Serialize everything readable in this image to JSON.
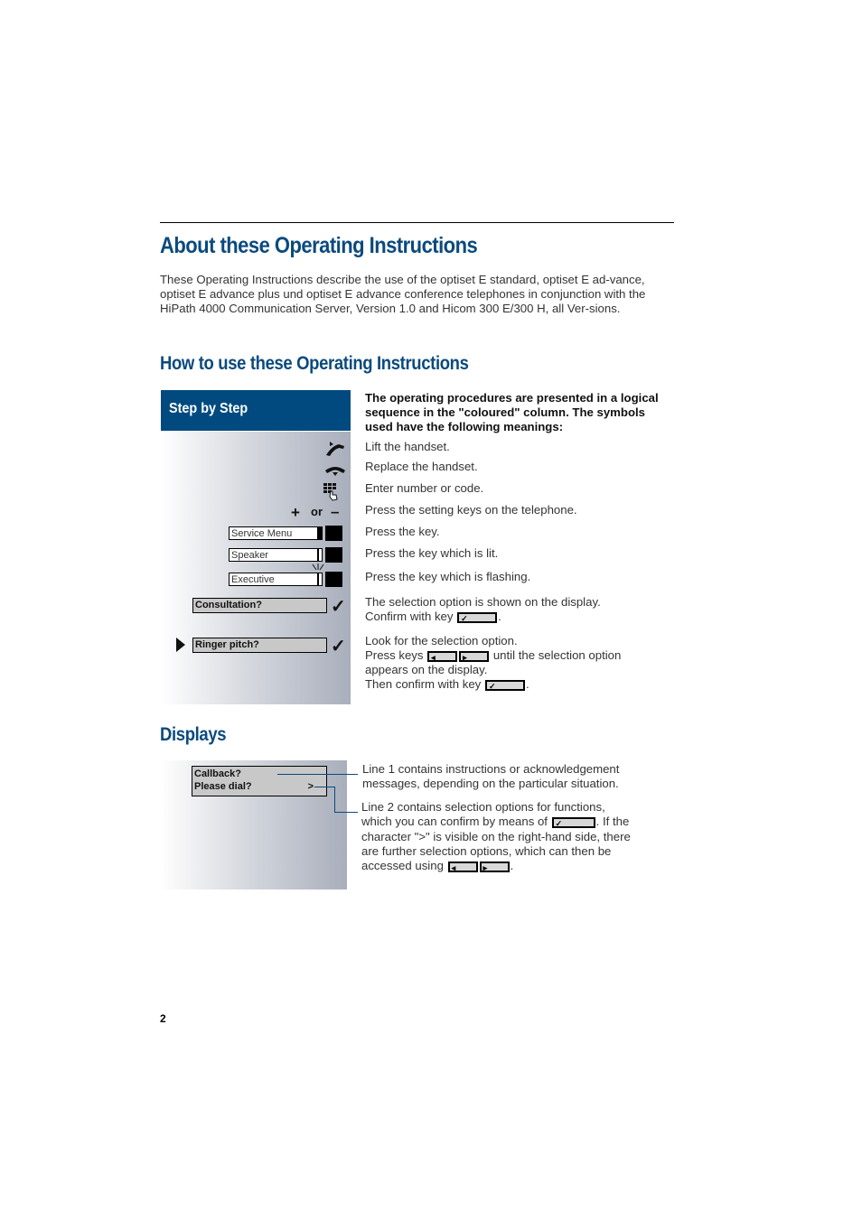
{
  "page": {
    "title": "About these Operating Instructions",
    "intro": "These Operating Instructions describe the use of the optiset E standard, optiset E ad-vance, optiset E advance plus und optiset E advance conference telephones in conjunction with the HiPath 4000 Communication Server, Version 1.0 and Hicom 300 E/300 H, all Ver-sions.",
    "page_number": "2"
  },
  "howto": {
    "heading": "How to use these Operating Instructions",
    "column_header": "Step by Step",
    "lead": "The operating procedures are presented in a logical sequence in the \"coloured\" column. The symbols used have the following meanings:",
    "rows": [
      {
        "icon": "lift-handset-icon",
        "text": "Lift the handset."
      },
      {
        "icon": "replace-handset-icon",
        "text": "Replace the handset."
      },
      {
        "icon": "keypad-icon",
        "text": "Enter number or code."
      },
      {
        "icon": "plus-minus-keys",
        "plus": "+",
        "or": "or",
        "minus": "–",
        "text": "Press the setting keys on the telephone."
      },
      {
        "key_label": "Service Menu",
        "text": "Press the key."
      },
      {
        "key_label": "Speaker",
        "text": "Press the key which is lit."
      },
      {
        "key_label": "Executive",
        "text": "Press the key which is flashing."
      },
      {
        "display": "Consultation?",
        "check": "✓",
        "text1": "The selection option is shown on the display.",
        "text2": "Confirm with key",
        "text2_end": "."
      },
      {
        "display": "Ringer pitch?",
        "check": "✓",
        "text1": "Look for the selection option.",
        "text2": "Press keys",
        "text2_after": "until the selection option",
        "text3": "appears on the display.",
        "text4": "Then confirm with key",
        "text4_end": "."
      }
    ]
  },
  "displays": {
    "heading": "Displays",
    "line1": "Callback?",
    "line2": "Please dial?",
    "more": ">",
    "desc1": "Line 1 contains instructions or acknowledgement messages, depending on the particular situation.",
    "desc2_a": "Line 2 contains selection options for functions,",
    "desc2_b": "which you can confirm by means of",
    "desc2_c": ". If the",
    "desc2_d": "character \">\" is visible on the right-hand side, there",
    "desc2_e": "are further selection options, which can then be",
    "desc2_f": "accessed using",
    "desc2_g": "."
  },
  "glyphs": {
    "check": "✓",
    "left": "◂",
    "right": "▸"
  }
}
